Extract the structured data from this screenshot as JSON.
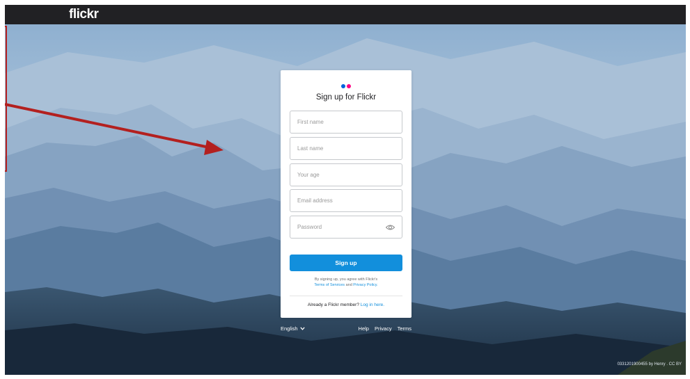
{
  "header": {
    "logo": "flickr"
  },
  "card": {
    "title": "Sign up for Flickr",
    "dot_colors": [
      "#0063dc",
      "#ff0084"
    ],
    "fields": {
      "first_name": "First name",
      "last_name": "Last name",
      "age": "Your age",
      "email": "Email address",
      "password": "Password"
    },
    "signup_button": "Sign up",
    "terms_prefix": "By signing up, you agree with Flickr's",
    "terms_link": "Terms of Services",
    "terms_and": "and",
    "privacy_link": "Privacy Policy.",
    "already_text": "Already a Flickr member?",
    "login_link": "Log in here."
  },
  "footer": {
    "language": "English",
    "links": [
      "Help",
      "Privacy",
      "Terms"
    ]
  },
  "photo_credit": "0331201900455 by Henry . CC BY",
  "colors": {
    "accent": "#128fdc",
    "annotation": "#b3201f",
    "topbar": "#212124"
  }
}
